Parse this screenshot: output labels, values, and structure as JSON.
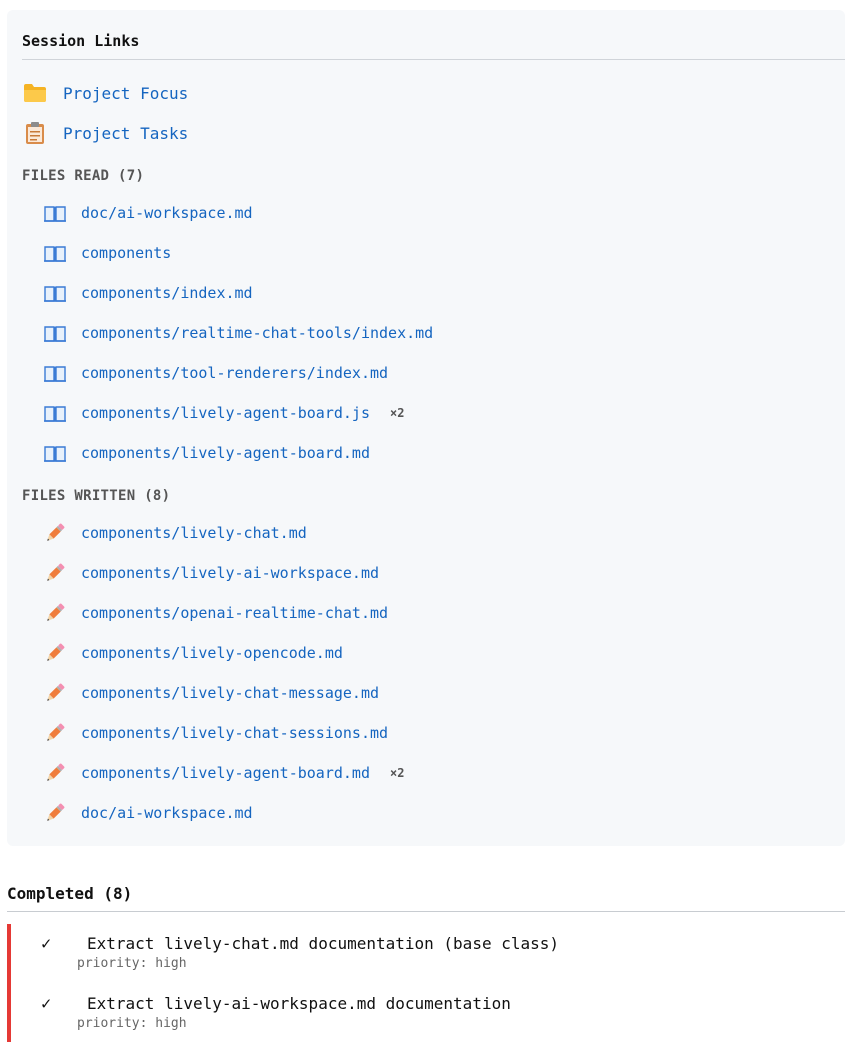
{
  "panel": {
    "title": "Session Links",
    "links": [
      {
        "label": "Project Focus",
        "icon": "folder-icon"
      },
      {
        "label": "Project Tasks",
        "icon": "clipboard-icon"
      }
    ]
  },
  "files_read": {
    "heading": "FILES READ (7)",
    "items": [
      {
        "path": "doc/ai-workspace.md",
        "count": ""
      },
      {
        "path": "components",
        "count": ""
      },
      {
        "path": "components/index.md",
        "count": ""
      },
      {
        "path": "components/realtime-chat-tools/index.md",
        "count": ""
      },
      {
        "path": "components/tool-renderers/index.md",
        "count": ""
      },
      {
        "path": "components/lively-agent-board.js",
        "count": "×2"
      },
      {
        "path": "components/lively-agent-board.md",
        "count": ""
      }
    ]
  },
  "files_written": {
    "heading": "FILES WRITTEN (8)",
    "items": [
      {
        "path": "components/lively-chat.md",
        "count": ""
      },
      {
        "path": "components/lively-ai-workspace.md",
        "count": ""
      },
      {
        "path": "components/openai-realtime-chat.md",
        "count": ""
      },
      {
        "path": "components/lively-opencode.md",
        "count": ""
      },
      {
        "path": "components/lively-chat-message.md",
        "count": ""
      },
      {
        "path": "components/lively-chat-sessions.md",
        "count": ""
      },
      {
        "path": "components/lively-agent-board.md",
        "count": "×2"
      },
      {
        "path": "doc/ai-workspace.md",
        "count": ""
      }
    ]
  },
  "completed": {
    "title": "Completed (8)",
    "accent_color": "#e53935",
    "items": [
      {
        "check": "✓",
        "text": "Extract lively-chat.md documentation (base class)",
        "meta": "priority: high"
      },
      {
        "check": "✓",
        "text": "Extract lively-ai-workspace.md documentation",
        "meta": "priority: high"
      }
    ]
  }
}
